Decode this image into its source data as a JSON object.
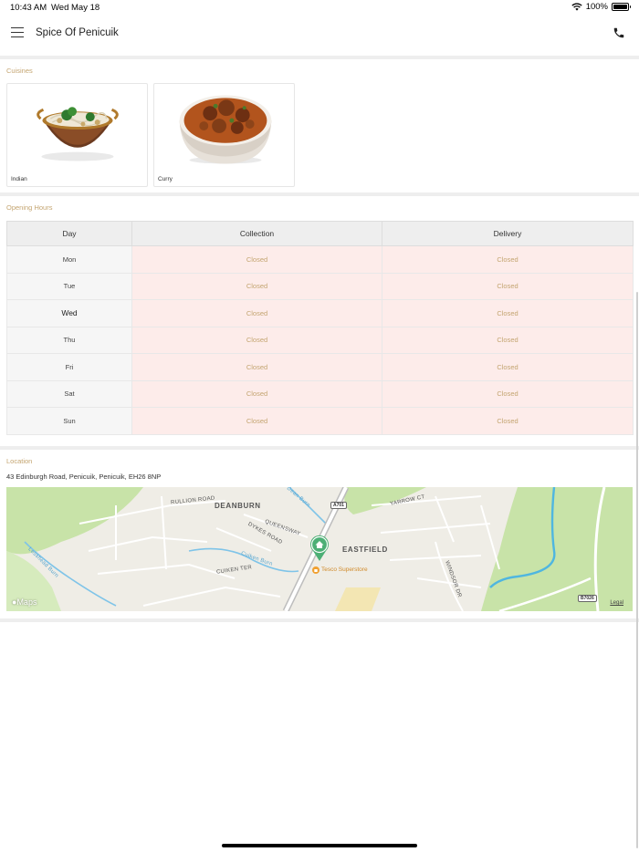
{
  "status_bar": {
    "time": "10:43 AM",
    "date": "Wed May 18",
    "battery": "100%",
    "battery_level": 1.0
  },
  "nav": {
    "title": "Spice Of Penicuik",
    "menu_icon": "hamburger-menu-icon",
    "call_icon": "phone-icon"
  },
  "cuisines": {
    "heading": "Cuisines",
    "items": [
      {
        "name": "Indian",
        "image": "noodle-bowl-photo"
      },
      {
        "name": "Curry",
        "image": "curry-bowl-photo"
      }
    ]
  },
  "opening_hours": {
    "heading": "Opening Hours",
    "columns": [
      "Day",
      "Collection",
      "Delivery"
    ],
    "today": "Wed",
    "rows": [
      {
        "day": "Mon",
        "collection": "Closed",
        "delivery": "Closed"
      },
      {
        "day": "Tue",
        "collection": "Closed",
        "delivery": "Closed"
      },
      {
        "day": "Wed",
        "collection": "Closed",
        "delivery": "Closed"
      },
      {
        "day": "Thu",
        "collection": "Closed",
        "delivery": "Closed"
      },
      {
        "day": "Fri",
        "collection": "Closed",
        "delivery": "Closed"
      },
      {
        "day": "Sat",
        "collection": "Closed",
        "delivery": "Closed"
      },
      {
        "day": "Sun",
        "collection": "Closed",
        "delivery": "Closed"
      }
    ]
  },
  "location": {
    "heading": "Location",
    "address": "43 Edinburgh Road, Penicuik, Penicuik, EH26 8NP",
    "map": {
      "places": [
        "DEANBURN",
        "EASTFIELD"
      ],
      "streets": [
        "RULLION ROAD",
        "Dean Burn",
        "YARROW CT",
        "DYKES ROAD",
        "QUEENSWAY",
        "Cuiken Burn",
        "CUIKEN TER",
        "WINDSOR DR",
        "Lesshead Burn"
      ],
      "road_badges": [
        "A701",
        "B7026"
      ],
      "poi": "Tesco Superstore",
      "brand": "Maps",
      "legal": "Legal",
      "pin_icon": "home-pin-icon"
    }
  },
  "colors": {
    "accent": "#c4a571",
    "closed_bg": "#fdecea",
    "divider": "#eeeeee",
    "map_green": "#c8e3a8",
    "map_water": "#7fc4e8"
  }
}
